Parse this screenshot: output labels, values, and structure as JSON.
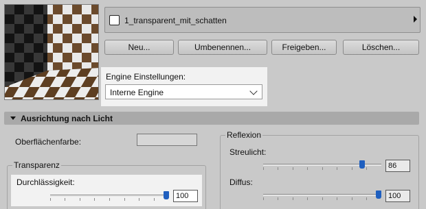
{
  "material": {
    "name": "1_transparent_mit_schatten"
  },
  "buttons": {
    "new": "Neu...",
    "rename": "Umbenennen...",
    "share": "Freigeben...",
    "delete": "Löschen..."
  },
  "engine": {
    "label": "Engine Einstellungen:",
    "selected": "Interne Engine"
  },
  "section": {
    "title": "Ausrichtung nach Licht"
  },
  "surface": {
    "label": "Oberflächenfarbe:"
  },
  "transparency": {
    "group_title": "Transparenz",
    "permeability_label": "Durchlässigkeit:",
    "permeability_value": "100",
    "permeability_level": 100
  },
  "reflection": {
    "group_title": "Reflexion",
    "scatter_label": "Streulicht:",
    "scatter_value": "86",
    "scatter_level": 86,
    "diffuse_label": "Diffus:",
    "diffuse_value": "100",
    "diffuse_level": 100
  }
}
